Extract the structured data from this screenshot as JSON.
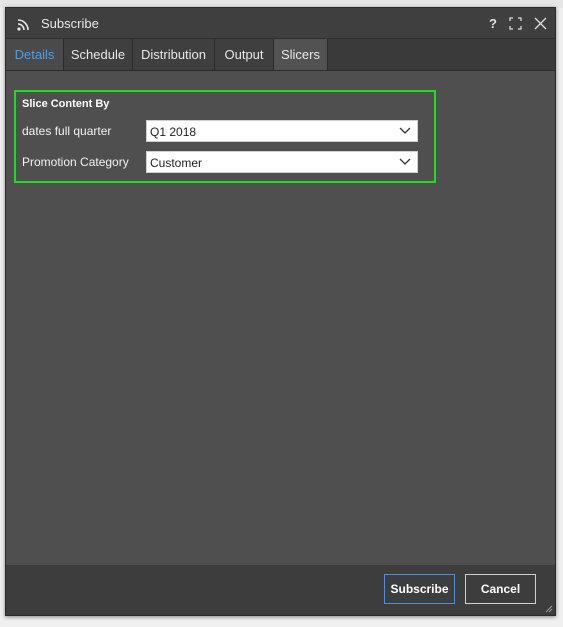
{
  "dialog": {
    "title": "Subscribe",
    "help_label": "?",
    "title_icon": "rss-icon",
    "max_icon": "maximize-icon",
    "close_icon": "close-icon"
  },
  "tabs": [
    {
      "label": "Details"
    },
    {
      "label": "Schedule"
    },
    {
      "label": "Distribution"
    },
    {
      "label": "Output"
    },
    {
      "label": "Slicers"
    }
  ],
  "slicers": {
    "heading": "Slice Content By",
    "fields": [
      {
        "label": "dates full quarter",
        "value": "Q1 2018"
      },
      {
        "label": "Promotion Category",
        "value": "Customer"
      }
    ]
  },
  "footer": {
    "subscribe_label": "Subscribe",
    "cancel_label": "Cancel"
  },
  "colors": {
    "accent": "#4a9fe8",
    "highlight_box": "#1fdc1f",
    "dialog_bg": "#4f4f4f"
  }
}
